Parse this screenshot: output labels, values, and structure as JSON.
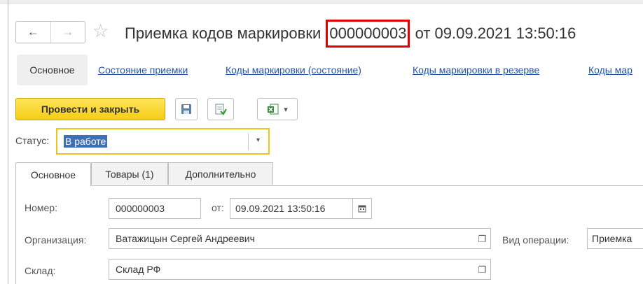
{
  "nav": {
    "back_icon": "←",
    "forward_icon": "→",
    "favorite_icon": "☆"
  },
  "title": {
    "prefix": "Приемка кодов маркировки ",
    "number": "000000003",
    "suffix": " от 09.09.2021 13:50:16"
  },
  "section_tabs": {
    "main": "Основное",
    "acceptance_status": "Состояние приемки",
    "marking_codes_status": "Коды маркировки (состояние)",
    "marking_codes_reserve": "Коды маркировки в резерве",
    "marking_codes_more": "Коды мар"
  },
  "toolbar": {
    "post_and_close": "Провести и закрыть",
    "excel_arrow": "▾"
  },
  "status": {
    "label": "Статус:",
    "value": "В работе",
    "arrow": "▾"
  },
  "tabs": {
    "main": "Основное",
    "goods": "Товары (1)",
    "additional": "Дополнительно"
  },
  "form": {
    "number_label": "Номер:",
    "number_value": "000000003",
    "date_label": "от:",
    "date_value": "09.09.2021 13:50:16",
    "organization_label": "Организация:",
    "organization_value": "Ватажицын Сергей Андреевич",
    "operation_label": "Вид операции:",
    "operation_value": "Приемка",
    "warehouse_label": "Склад:",
    "warehouse_value": "Склад РФ"
  },
  "colors": {
    "primary_button": "#f5cd17",
    "link": "#2453a8",
    "highlight_box": "#e00000",
    "focus_border": "#f0c419",
    "selection": "#3f6fb5"
  }
}
